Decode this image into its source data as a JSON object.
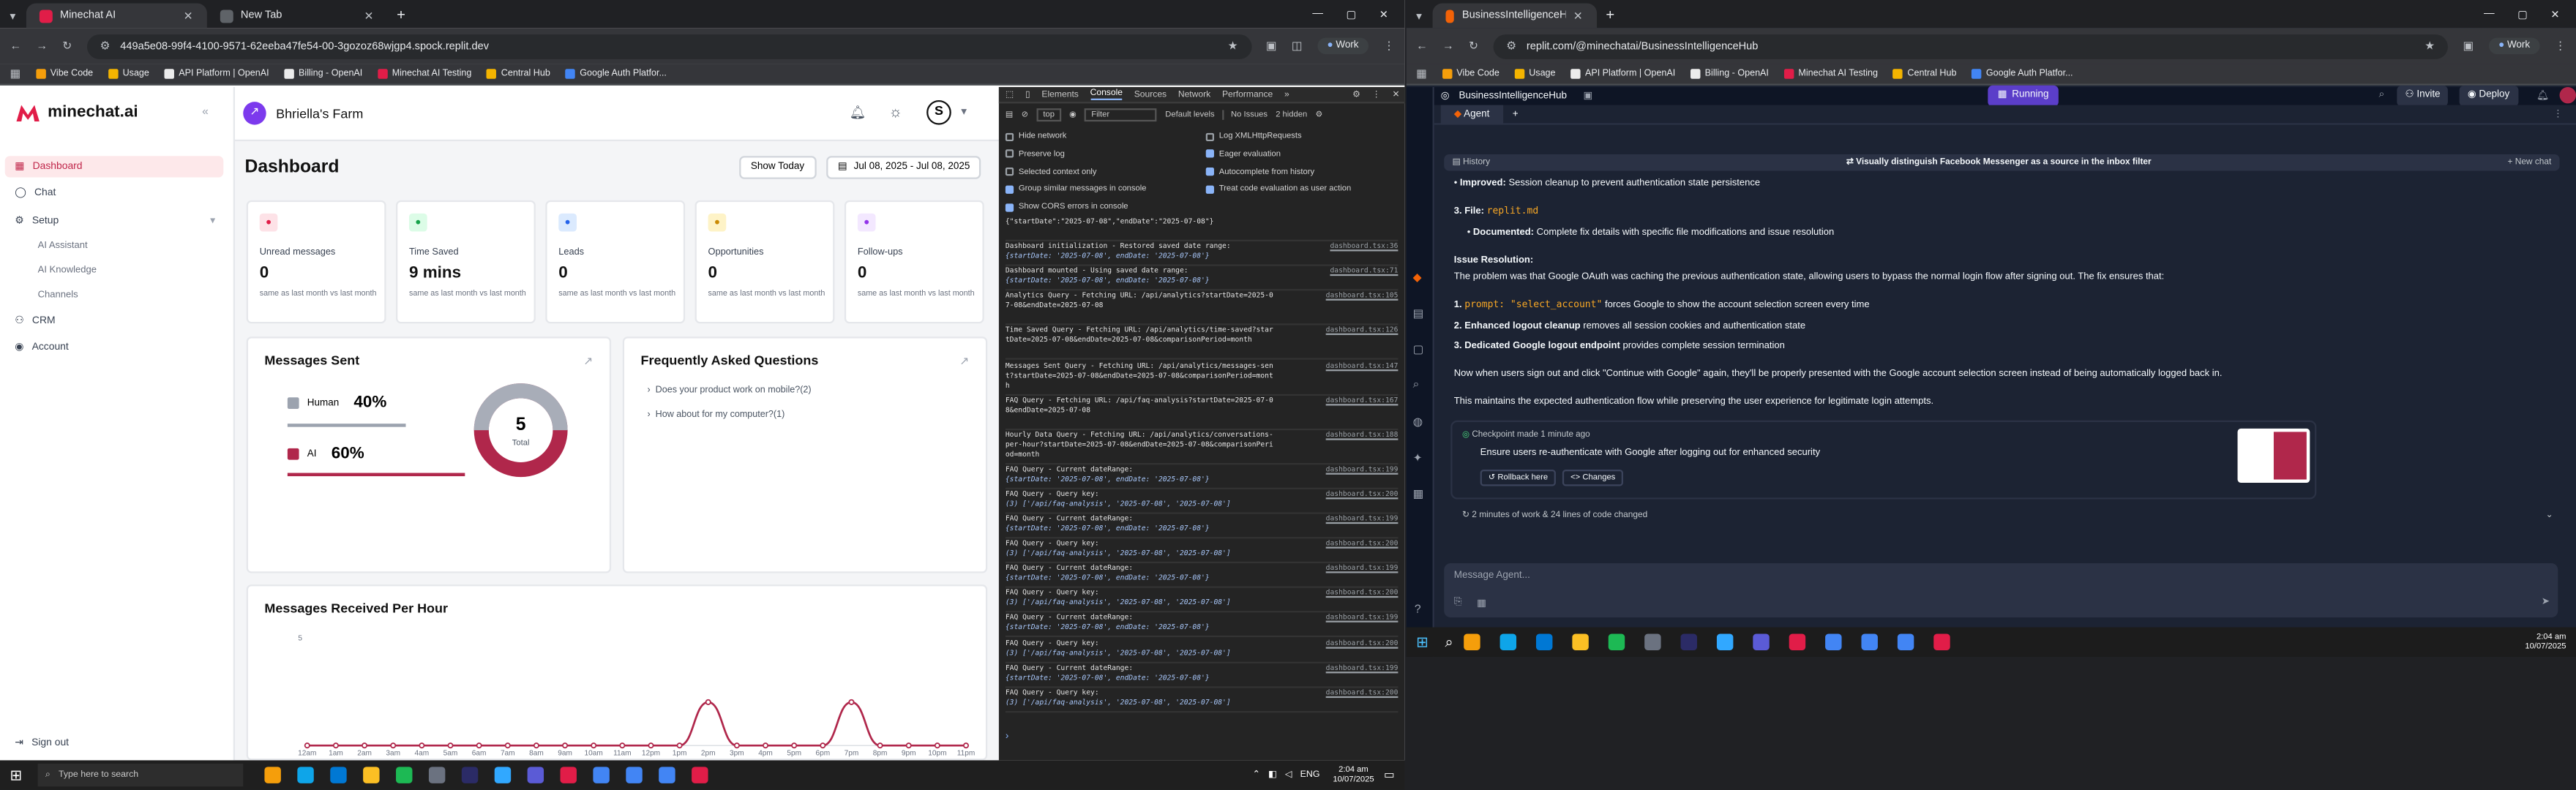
{
  "left_browser": {
    "tabs": [
      {
        "label": "Minechat AI",
        "active": true
      },
      {
        "label": "New Tab",
        "active": false
      }
    ],
    "url": "449a5e08-99f4-4100-9571-62eeba47fe54-00-3gozoz68wjgp4.spock.replit.dev",
    "profile": "Work",
    "bookmarks": [
      "Vibe Code",
      "Usage",
      "API Platform | OpenAI",
      "Billing - OpenAI",
      "Minechat AI Testing",
      "Central Hub",
      "Google Auth Platfor..."
    ]
  },
  "app": {
    "logo": "minechat.ai",
    "nav": {
      "dashboard": "Dashboard",
      "chat": "Chat",
      "setup": "Setup",
      "ai_assistant": "AI Assistant",
      "ai_knowledge": "AI Knowledge",
      "channels": "Channels",
      "crm": "CRM",
      "account": "Account",
      "signout": "Sign out"
    },
    "farm": "Bhriella's Farm",
    "page_title": "Dashboard",
    "show_today": "Show Today",
    "date_range": "Jul 08, 2025 - Jul 08, 2025",
    "kpis": [
      {
        "title": "Unread messages",
        "value": "0",
        "sub": "same as last month vs last month",
        "color": "#e11d48",
        "bg": "#fde2e7",
        "icon": "message-icon"
      },
      {
        "title": "Time Saved",
        "value": "9 mins",
        "sub": "same as last month vs last month",
        "color": "#16a34a",
        "bg": "#dcfce7",
        "icon": "clock-icon"
      },
      {
        "title": "Leads",
        "value": "0",
        "sub": "same as last month vs last month",
        "color": "#2563eb",
        "bg": "#dbeafe",
        "icon": "users-icon"
      },
      {
        "title": "Opportunities",
        "value": "0",
        "sub": "same as last month vs last month",
        "color": "#ca8a04",
        "bg": "#fef3c7",
        "icon": "trend-icon"
      },
      {
        "title": "Follow-ups",
        "value": "0",
        "sub": "same as last month vs last month",
        "color": "#9333ea",
        "bg": "#f3e8ff",
        "icon": "phone-icon"
      }
    ],
    "messages_sent": {
      "title": "Messages Sent",
      "human_label": "Human",
      "human_pct": "40%",
      "ai_label": "AI",
      "ai_pct": "60%",
      "total_value": "5",
      "total_label": "Total"
    },
    "faq": {
      "title": "Frequently Asked Questions",
      "items": [
        "Does your product work on mobile?(2)",
        "How about for my computer?(1)"
      ]
    },
    "received": {
      "title": "Messages Received Per Hour"
    }
  },
  "chart_data": {
    "type": "line",
    "title": "Messages Received Per Hour",
    "categories": [
      "12am",
      "1am",
      "2am",
      "3am",
      "4am",
      "5am",
      "6am",
      "7am",
      "8am",
      "9am",
      "10am",
      "11am",
      "12pm",
      "1pm",
      "2pm",
      "3pm",
      "4pm",
      "5pm",
      "6pm",
      "7pm",
      "8pm",
      "9pm",
      "10pm",
      "11pm"
    ],
    "series": [
      {
        "values": [
          0,
          0,
          0,
          0,
          0,
          0,
          0,
          0,
          0,
          0,
          0,
          0,
          0,
          0,
          2,
          0,
          0,
          0,
          0,
          2,
          0,
          0,
          0,
          0
        ]
      }
    ],
    "ylim": [
      0,
      5
    ],
    "y_ticks": [
      "5"
    ],
    "color": "#b0274b"
  },
  "devtools": {
    "tabs": [
      "Elements",
      "Console",
      "Sources",
      "Network",
      "Performance"
    ],
    "top": "top",
    "filter": "Filter",
    "levels": "Default levels",
    "issues": "No Issues",
    "hidden": "2 hidden",
    "options_left": [
      "Hide network",
      "Preserve log",
      "Selected context only",
      "Group similar messages in console",
      "Show CORS errors in console"
    ],
    "options_right": [
      "Log XMLHttpRequests",
      "Eager evaluation",
      "Autocomplete from history",
      "Treat code evaluation as user action"
    ],
    "logs": [
      {
        "text": "{\"startDate\":\"2025-07-08\",\"endDate\":\"2025-07-08\"}",
        "obj": "",
        "src": ""
      },
      {
        "text": "Dashboard initialization - Restored saved date range:",
        "obj": "{startDate: '2025-07-08', endDate: '2025-07-08'}",
        "src": "dashboard.tsx:36"
      },
      {
        "text": "Dashboard mounted - Using saved date range:",
        "obj": "{startDate: '2025-07-08', endDate: '2025-07-08'}",
        "src": "dashboard.tsx:71"
      },
      {
        "text": "Analytics Query - Fetching URL: /api/analytics?startDate=2025-07-08&endDate=2025-07-08",
        "obj": "",
        "src": "dashboard.tsx:105"
      },
      {
        "text": "Time Saved Query - Fetching URL: /api/analytics/time-saved?startDate=2025-07-08&endDate=2025-07-08&comparisonPeriod=month",
        "obj": "",
        "src": "dashboard.tsx:126"
      },
      {
        "text": "Messages Sent Query - Fetching URL: /api/analytics/messages-sent?startDate=2025-07-08&endDate=2025-07-08&comparisonPeriod=month",
        "obj": "",
        "src": "dashboard.tsx:147"
      },
      {
        "text": "FAQ Query - Fetching URL: /api/faq-analysis?startDate=2025-07-08&endDate=2025-07-08",
        "obj": "",
        "src": "dashboard.tsx:167"
      },
      {
        "text": "Hourly Data Query - Fetching URL: /api/analytics/conversations-per-hour?startDate=2025-07-08&endDate=2025-07-08&comparisonPeriod=month",
        "obj": "",
        "src": "dashboard.tsx:188"
      },
      {
        "text": "FAQ Query - Current dateRange:",
        "obj": "{startDate: '2025-07-08', endDate: '2025-07-08'}",
        "src": "dashboard.tsx:199"
      },
      {
        "text": "FAQ Query - Query key:",
        "obj": "(3) ['/api/faq-analysis', '2025-07-08', '2025-07-08']",
        "src": "dashboard.tsx:200"
      },
      {
        "text": "FAQ Query - Current dateRange:",
        "obj": "{startDate: '2025-07-08', endDate: '2025-07-08'}",
        "src": "dashboard.tsx:199"
      },
      {
        "text": "FAQ Query - Query key:",
        "obj": "(3) ['/api/faq-analysis', '2025-07-08', '2025-07-08']",
        "src": "dashboard.tsx:200"
      },
      {
        "text": "FAQ Query - Current dateRange:",
        "obj": "{startDate: '2025-07-08', endDate: '2025-07-08'}",
        "src": "dashboard.tsx:199"
      },
      {
        "text": "FAQ Query - Query key:",
        "obj": "(3) ['/api/faq-analysis', '2025-07-08', '2025-07-08']",
        "src": "dashboard.tsx:200"
      },
      {
        "text": "FAQ Query - Current dateRange:",
        "obj": "{startDate: '2025-07-08', endDate: '2025-07-08'}",
        "src": "dashboard.tsx:199"
      },
      {
        "text": "FAQ Query - Query key:",
        "obj": "(3) ['/api/faq-analysis', '2025-07-08', '2025-07-08']",
        "src": "dashboard.tsx:200"
      },
      {
        "text": "FAQ Query - Current dateRange:",
        "obj": "{startDate: '2025-07-08', endDate: '2025-07-08'}",
        "src": "dashboard.tsx:199"
      },
      {
        "text": "FAQ Query - Query key:",
        "obj": "(3) ['/api/faq-analysis', '2025-07-08', '2025-07-08']",
        "src": "dashboard.tsx:200"
      }
    ]
  },
  "right_browser": {
    "tabs": [
      {
        "label": "BusinessIntelligenceHub - Repli",
        "active": true
      }
    ],
    "url": "replit.com/@minechatai/BusinessIntelligenceHub",
    "profile": "Work",
    "bookmarks": [
      "Vibe Code",
      "Usage",
      "API Platform | OpenAI",
      "Billing - OpenAI",
      "Minechat AI Testing",
      "Central Hub",
      "Google Auth Platfor..."
    ],
    "project": "BusinessIntelligenceHub",
    "running": "Running",
    "invite": "Invite",
    "deploy": "Deploy",
    "agent_tab": "Agent",
    "history": "History",
    "thread_title": "Visually distinguish Facebook Messenger as a source in the inbox filter",
    "new_chat": "+ New chat",
    "improved_label": "Improved:",
    "improved_text": "Session cleanup to prevent authentication state persistence",
    "file_num": "3. File:",
    "file_name": "replit.md",
    "documented_label": "Documented:",
    "documented_text": "Complete fix details with specific file modifications and issue resolution",
    "issue_heading": "Issue Resolution:",
    "issue_text": "The problem was that Google OAuth was caching the previous authentication state, allowing users to bypass the normal login flow after signing out. The fix ensures that:",
    "points": [
      {
        "num": "1.",
        "code": "prompt: \"select_account\"",
        "rest": "forces Google to show the account selection screen every time"
      },
      {
        "num": "2.",
        "bold": "Enhanced logout cleanup",
        "rest": "removes all session cookies and authentication state"
      },
      {
        "num": "3.",
        "bold": "Dedicated Google logout endpoint",
        "rest": "provides complete session termination"
      }
    ],
    "now_text": "Now when users sign out and click \"Continue with Google\" again, they'll be properly presented with the Google account selection screen instead of being automatically logged back in.",
    "maintain_text": "This maintains the expected authentication flow while preserving the user experience for legitimate login attempts.",
    "checkpoint": "Checkpoint made 1 minute ago",
    "checkpoint_desc": "Ensure users re-authenticate with Google after logging out for enhanced security",
    "rollback": "Rollback here",
    "changes": "Changes",
    "work_summary": "2 minutes of work & 24 lines of code changed",
    "message_placeholder": "Message Agent..."
  },
  "taskbar_main": {
    "search": "Type here to search",
    "lang": "ENG",
    "time": "2:04 am",
    "date": "10/07/2025"
  },
  "taskbar_right": {
    "time": "2:04 am",
    "date": "10/07/2025"
  }
}
